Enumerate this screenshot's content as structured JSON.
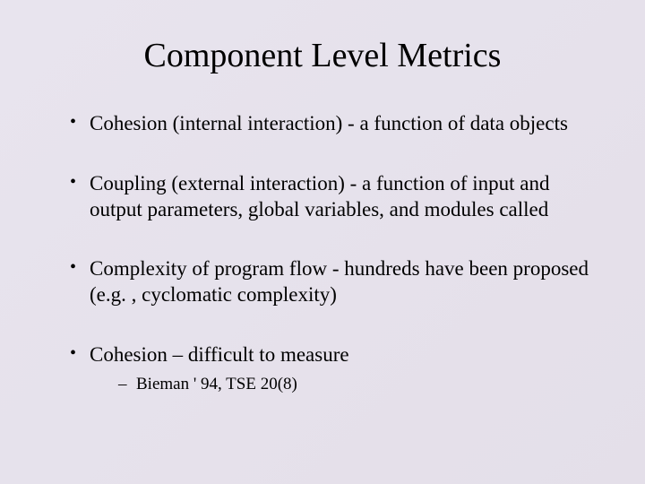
{
  "title": "Component Level Metrics",
  "bullets": [
    {
      "text": "Cohesion (internal interaction) - a function of data objects"
    },
    {
      "text": "Coupling (external interaction) - a function of input and output parameters, global variables, and modules called"
    },
    {
      "text": "Complexity of program flow - hundreds have been proposed (e.g. , cyclomatic complexity)"
    },
    {
      "text": "Cohesion – difficult to measure",
      "sub": [
        "Bieman ' 94, TSE 20(8)"
      ]
    }
  ]
}
